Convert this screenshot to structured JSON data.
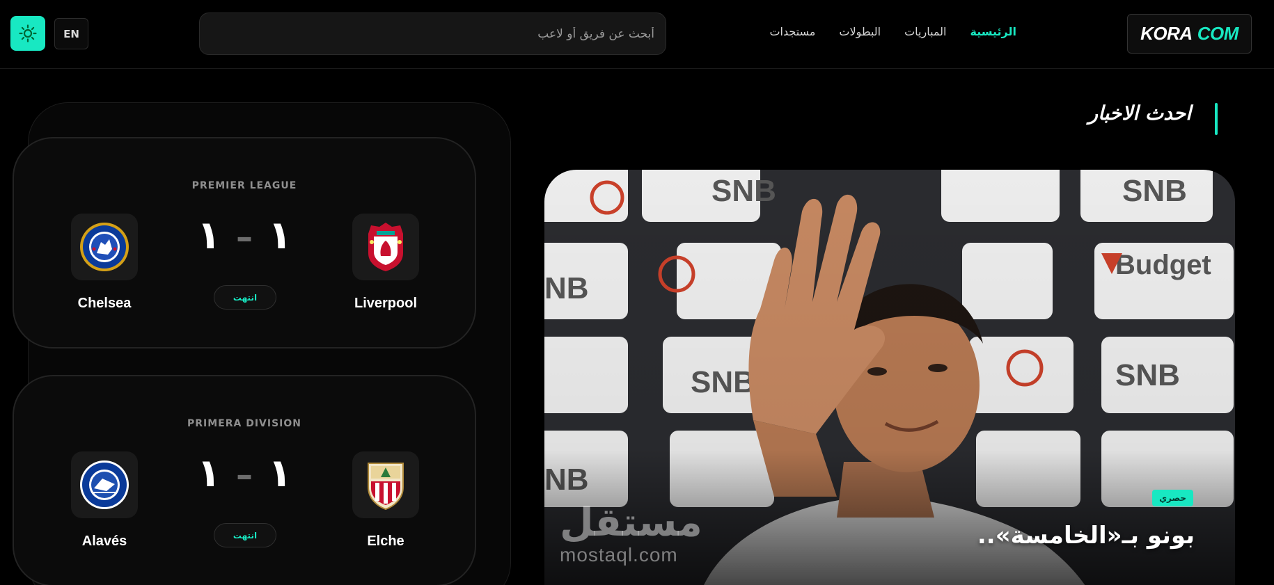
{
  "header": {
    "logo": {
      "part1": "KORA",
      "part2": "COM"
    },
    "nav": [
      {
        "label": "الرئيسية",
        "active": true
      },
      {
        "label": "المباريات",
        "active": false
      },
      {
        "label": "البطولات",
        "active": false
      },
      {
        "label": "مستجدات",
        "active": false
      }
    ],
    "search_placeholder": "أبحث عن فريق أو لاعب",
    "lang_label": "EN",
    "theme_icon": "sun-icon"
  },
  "news": {
    "section_title": "احدث الاخبار",
    "badge": "حصري",
    "headline": "بونو بـ«الخامسة»..",
    "watermark_ar": "مستقل",
    "watermark_en": "mostaql.com"
  },
  "matches": [
    {
      "league": "PREMIER LEAGUE",
      "home_team": "Liverpool",
      "away_team": "Chelsea",
      "home_score": "١",
      "away_score": "١",
      "status": "انتهت"
    },
    {
      "league": "PRIMERA DIVISION",
      "home_team": "Elche",
      "away_team": "Alavés",
      "home_score": "١",
      "away_score": "١",
      "status": "انتهت"
    }
  ],
  "colors": {
    "accent": "#18e8c2",
    "background": "#000000",
    "card": "#0b0b0b"
  }
}
